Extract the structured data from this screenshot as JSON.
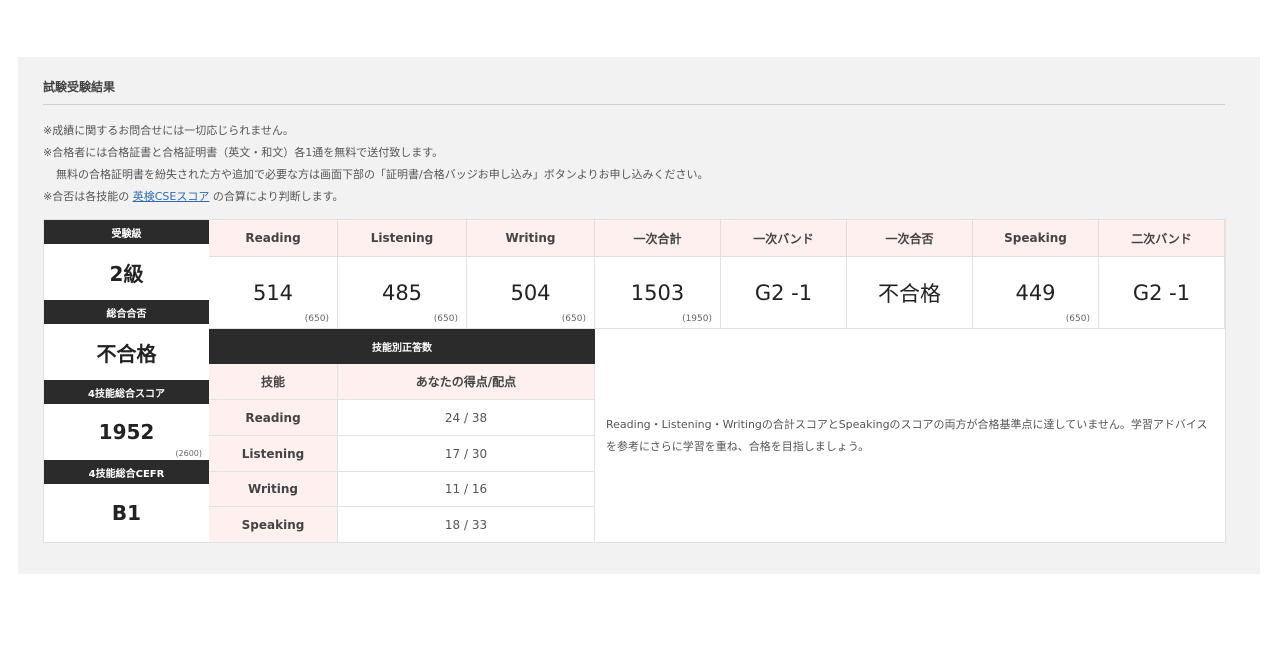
{
  "section_title": "試験受験結果",
  "notes": [
    "※成績に関するお問合せには一切応じられません。",
    "※合格者には合格証書と合格証明書（英文・和文）各1通を無料で送付致します。",
    "無料の合格証明書を紛失された方や追加で必要な方は画面下部の「証明書/合格バッジお申し込み」ボタンよりお申し込みください。"
  ],
  "note4": {
    "prefix": "※合否は各技能の ",
    "link": "英検CSEスコア",
    "suffix": " の合算により判断します。"
  },
  "left": {
    "grade_label": "受験級",
    "grade": "2級",
    "overall_label": "総合合否",
    "overall": "不合格",
    "total_label": "4技能総合スコア",
    "total": "1952",
    "total_max": "(2600)",
    "cefr_label": "4技能総合CEFR",
    "cefr": "B1"
  },
  "scores": [
    {
      "label": "Reading",
      "value": "514",
      "max": "(650)"
    },
    {
      "label": "Listening",
      "value": "485",
      "max": "(650)"
    },
    {
      "label": "Writing",
      "value": "504",
      "max": "(650)"
    },
    {
      "label": "一次合計",
      "value": "1503",
      "max": "(1950)"
    },
    {
      "label": "一次バンド",
      "value": "G2 -1",
      "max": ""
    },
    {
      "label": "一次合否",
      "value": "不合格",
      "max": ""
    },
    {
      "label": "Speaking",
      "value": "449",
      "max": "(650)"
    },
    {
      "label": "二次バンド",
      "value": "G2 -1",
      "max": ""
    }
  ],
  "skills_table": {
    "title": "技能別正答数",
    "col_skill": "技能",
    "col_score": "あなたの得点/配点",
    "rows": [
      {
        "skill": "Reading",
        "score": "24 / 38"
      },
      {
        "skill": "Listening",
        "score": "17 / 30"
      },
      {
        "skill": "Writing",
        "score": "11 / 16"
      },
      {
        "skill": "Speaking",
        "score": "18 / 33"
      }
    ]
  },
  "advice": "Reading・Listening・Writingの合計スコアとSpeakingのスコアの両方が合格基準点に達していません。学習アドバイスを参考にさらに学習を重ね、合格を目指しましょう。"
}
